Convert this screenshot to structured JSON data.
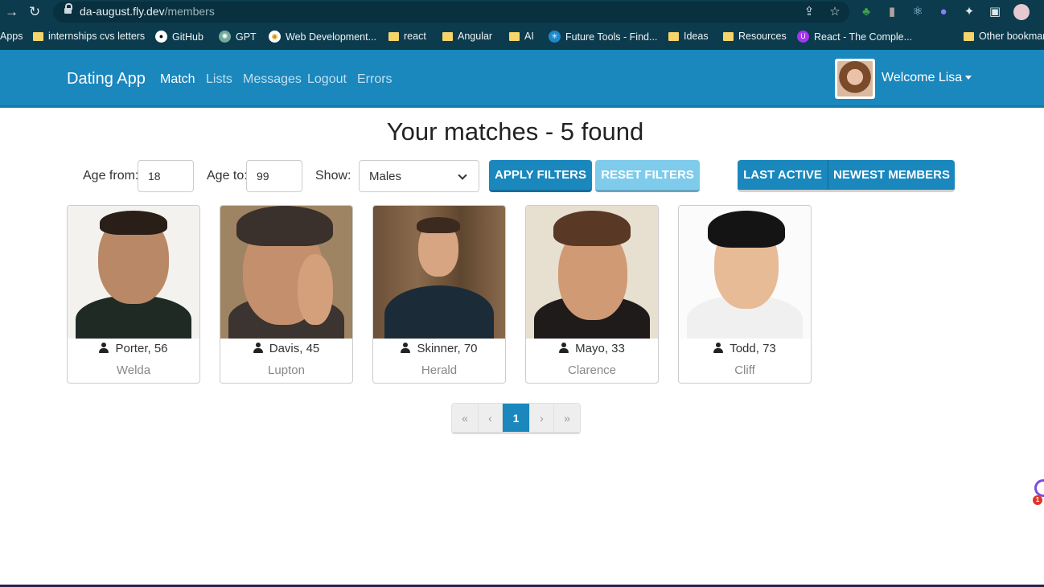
{
  "browser": {
    "url_host": "da-august.fly.dev",
    "url_path": "/members",
    "bookmarks": [
      {
        "label": "Apps",
        "icon": "apps-icon"
      },
      {
        "label": "internships cvs letters",
        "icon": "folder-icon"
      },
      {
        "label": "GitHub",
        "icon": "github-icon"
      },
      {
        "label": "GPT",
        "icon": "openai-icon"
      },
      {
        "label": "Web Development...",
        "icon": "web-dev-icon"
      },
      {
        "label": "react",
        "icon": "folder-icon"
      },
      {
        "label": "Angular",
        "icon": "folder-icon"
      },
      {
        "label": "AI",
        "icon": "folder-icon"
      },
      {
        "label": "Future Tools - Find...",
        "icon": "future-tools-icon"
      },
      {
        "label": "Ideas",
        "icon": "folder-icon"
      },
      {
        "label": "Resources",
        "icon": "folder-icon"
      },
      {
        "label": "React - The Comple...",
        "icon": "udemy-icon"
      },
      {
        "label": "Other bookmarks",
        "icon": "folder-icon"
      }
    ]
  },
  "navbar": {
    "brand": "Dating App",
    "links": [
      "Match",
      "Lists",
      "Messages",
      "Logout",
      "Errors"
    ],
    "active_link": "Match",
    "welcome": "Welcome Lisa"
  },
  "page": {
    "title": "Your matches - 5 found"
  },
  "filters": {
    "age_from_label": "Age from:",
    "age_from_value": "18",
    "age_to_label": "Age to:",
    "age_to_value": "99",
    "show_label": "Show:",
    "show_value": "Males",
    "apply_label": "APPLY FILTERS",
    "reset_label": "RESET FILTERS",
    "sort_last_active": "LAST ACTIVE",
    "sort_newest": "NEWEST MEMBERS"
  },
  "members": [
    {
      "name_age": "Porter, 56",
      "city": "Welda"
    },
    {
      "name_age": "Davis, 45",
      "city": "Lupton"
    },
    {
      "name_age": "Skinner, 70",
      "city": "Herald"
    },
    {
      "name_age": "Mayo, 33",
      "city": "Clarence"
    },
    {
      "name_age": "Todd, 73",
      "city": "Cliff"
    }
  ],
  "pagination": {
    "first": "«",
    "prev": "‹",
    "current": "1",
    "next": "›",
    "last": "»"
  },
  "colors": {
    "primary": "#1a87bd",
    "info": "#7fcbeb",
    "chrome": "#0b3b4d"
  },
  "side_widget": {
    "badge": "1"
  }
}
